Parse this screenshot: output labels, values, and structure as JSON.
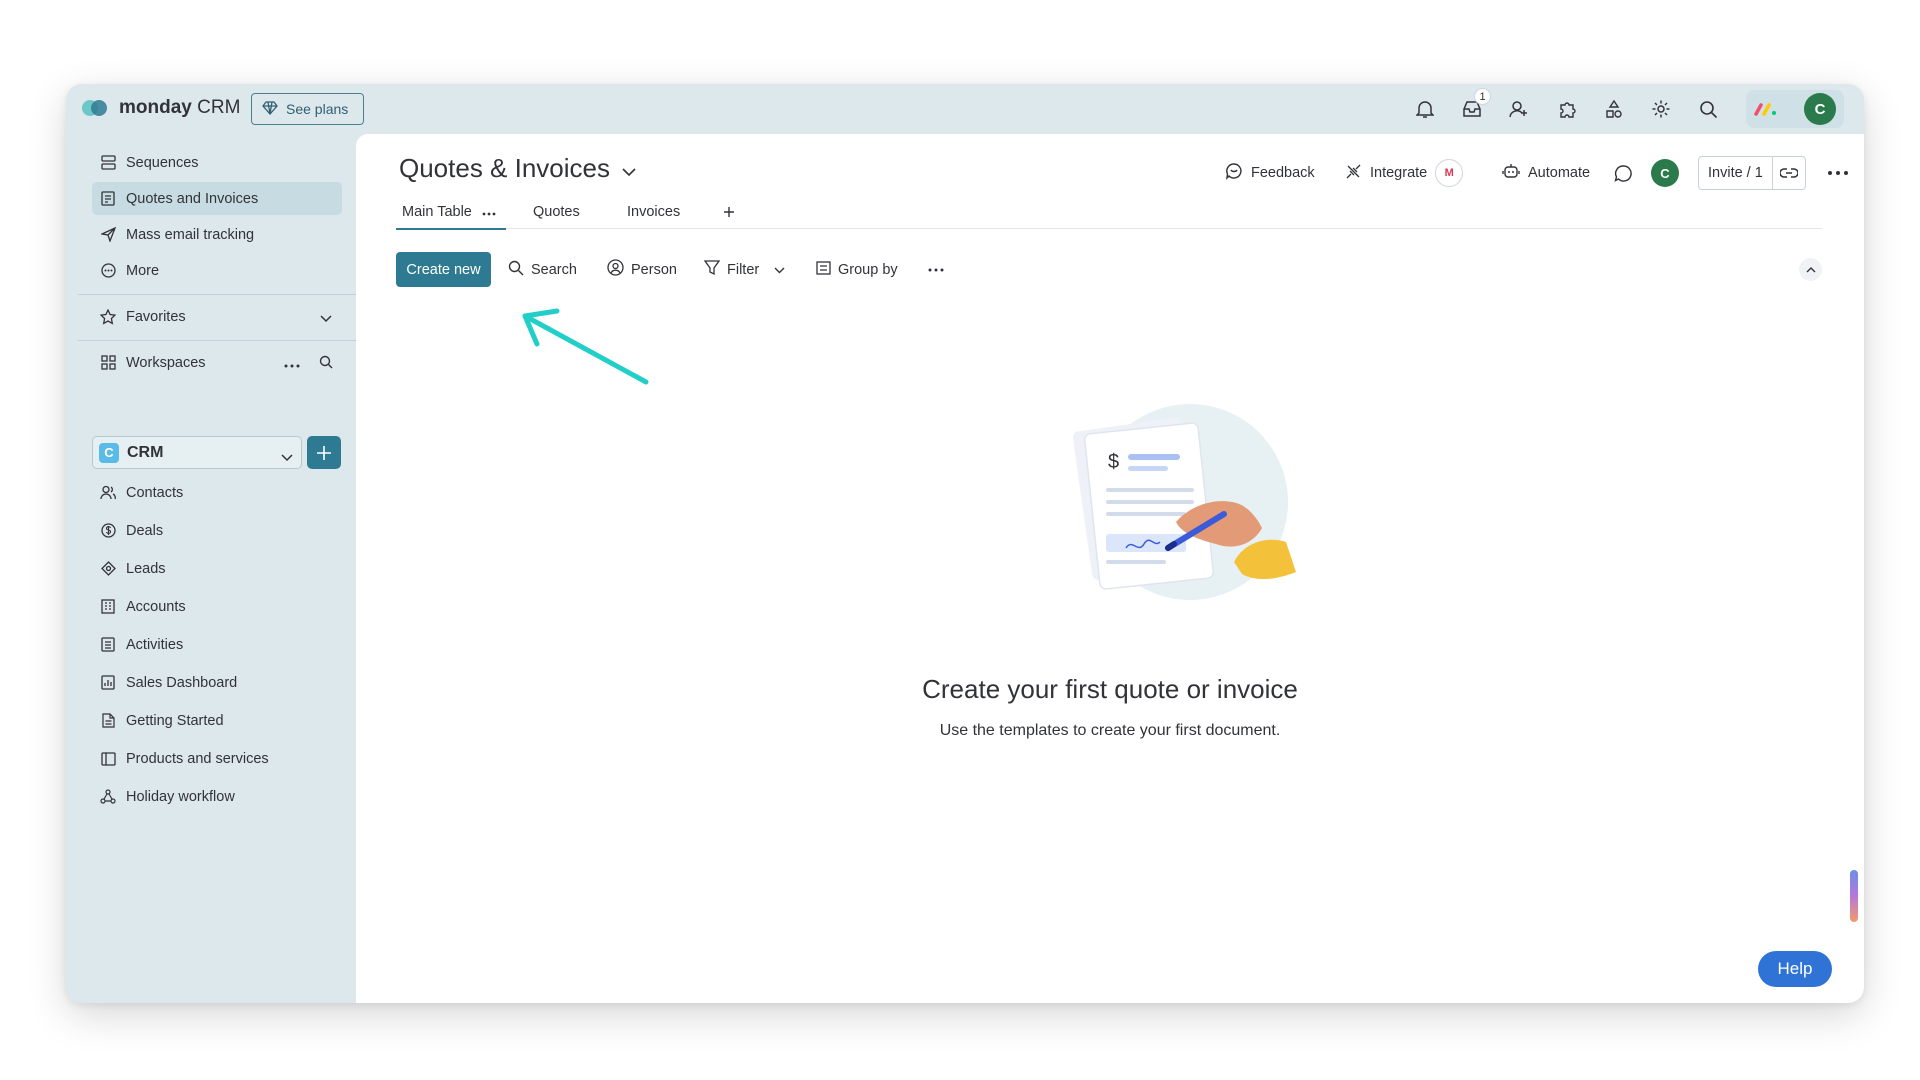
{
  "app": {
    "brand_bold": "monday",
    "brand_rest": " CRM",
    "see_plans": "See plans"
  },
  "topbar": {
    "inbox_count": "1",
    "avatar_letter": "C"
  },
  "sidebar": {
    "top_items": [
      {
        "label": "Sequences",
        "icon": "sequences-icon"
      },
      {
        "label": "Quotes and Invoices",
        "icon": "quotes-icon"
      },
      {
        "label": "Mass email tracking",
        "icon": "send-icon"
      },
      {
        "label": "More",
        "icon": "more-circle-icon"
      }
    ],
    "favorites": "Favorites",
    "workspaces": "Workspaces",
    "workspace": {
      "letter": "C",
      "name": "CRM"
    },
    "boards": [
      {
        "label": "Contacts",
        "icon": "contacts-icon"
      },
      {
        "label": "Deals",
        "icon": "dollar-icon"
      },
      {
        "label": "Leads",
        "icon": "target-icon"
      },
      {
        "label": "Accounts",
        "icon": "building-icon"
      },
      {
        "label": "Activities",
        "icon": "checklist-icon"
      },
      {
        "label": "Sales Dashboard",
        "icon": "dashboard-icon"
      },
      {
        "label": "Getting Started",
        "icon": "doc-icon"
      },
      {
        "label": "Products and services",
        "icon": "board-icon"
      },
      {
        "label": "Holiday workflow",
        "icon": "workflow-icon"
      }
    ]
  },
  "board": {
    "title": "Quotes & Invoices",
    "feedback": "Feedback",
    "integrate": "Integrate",
    "integrate_badge": "M",
    "automate": "Automate",
    "avatar_letter": "C",
    "invite": "Invite / 1"
  },
  "tabs": [
    "Main Table",
    "Quotes",
    "Invoices"
  ],
  "toolbar": {
    "create_new": "Create new",
    "search": "Search",
    "person": "Person",
    "filter": "Filter",
    "group_by": "Group by"
  },
  "empty_state": {
    "title": "Create your first quote or invoice",
    "subtitle": "Use the templates to create your first document.",
    "illustration_symbol": "$"
  },
  "help": "Help",
  "colors": {
    "accent": "#2f7a93",
    "help": "#2f73d6",
    "arrow": "#22cfc8",
    "sidebar_bg": "#dde8ec"
  }
}
